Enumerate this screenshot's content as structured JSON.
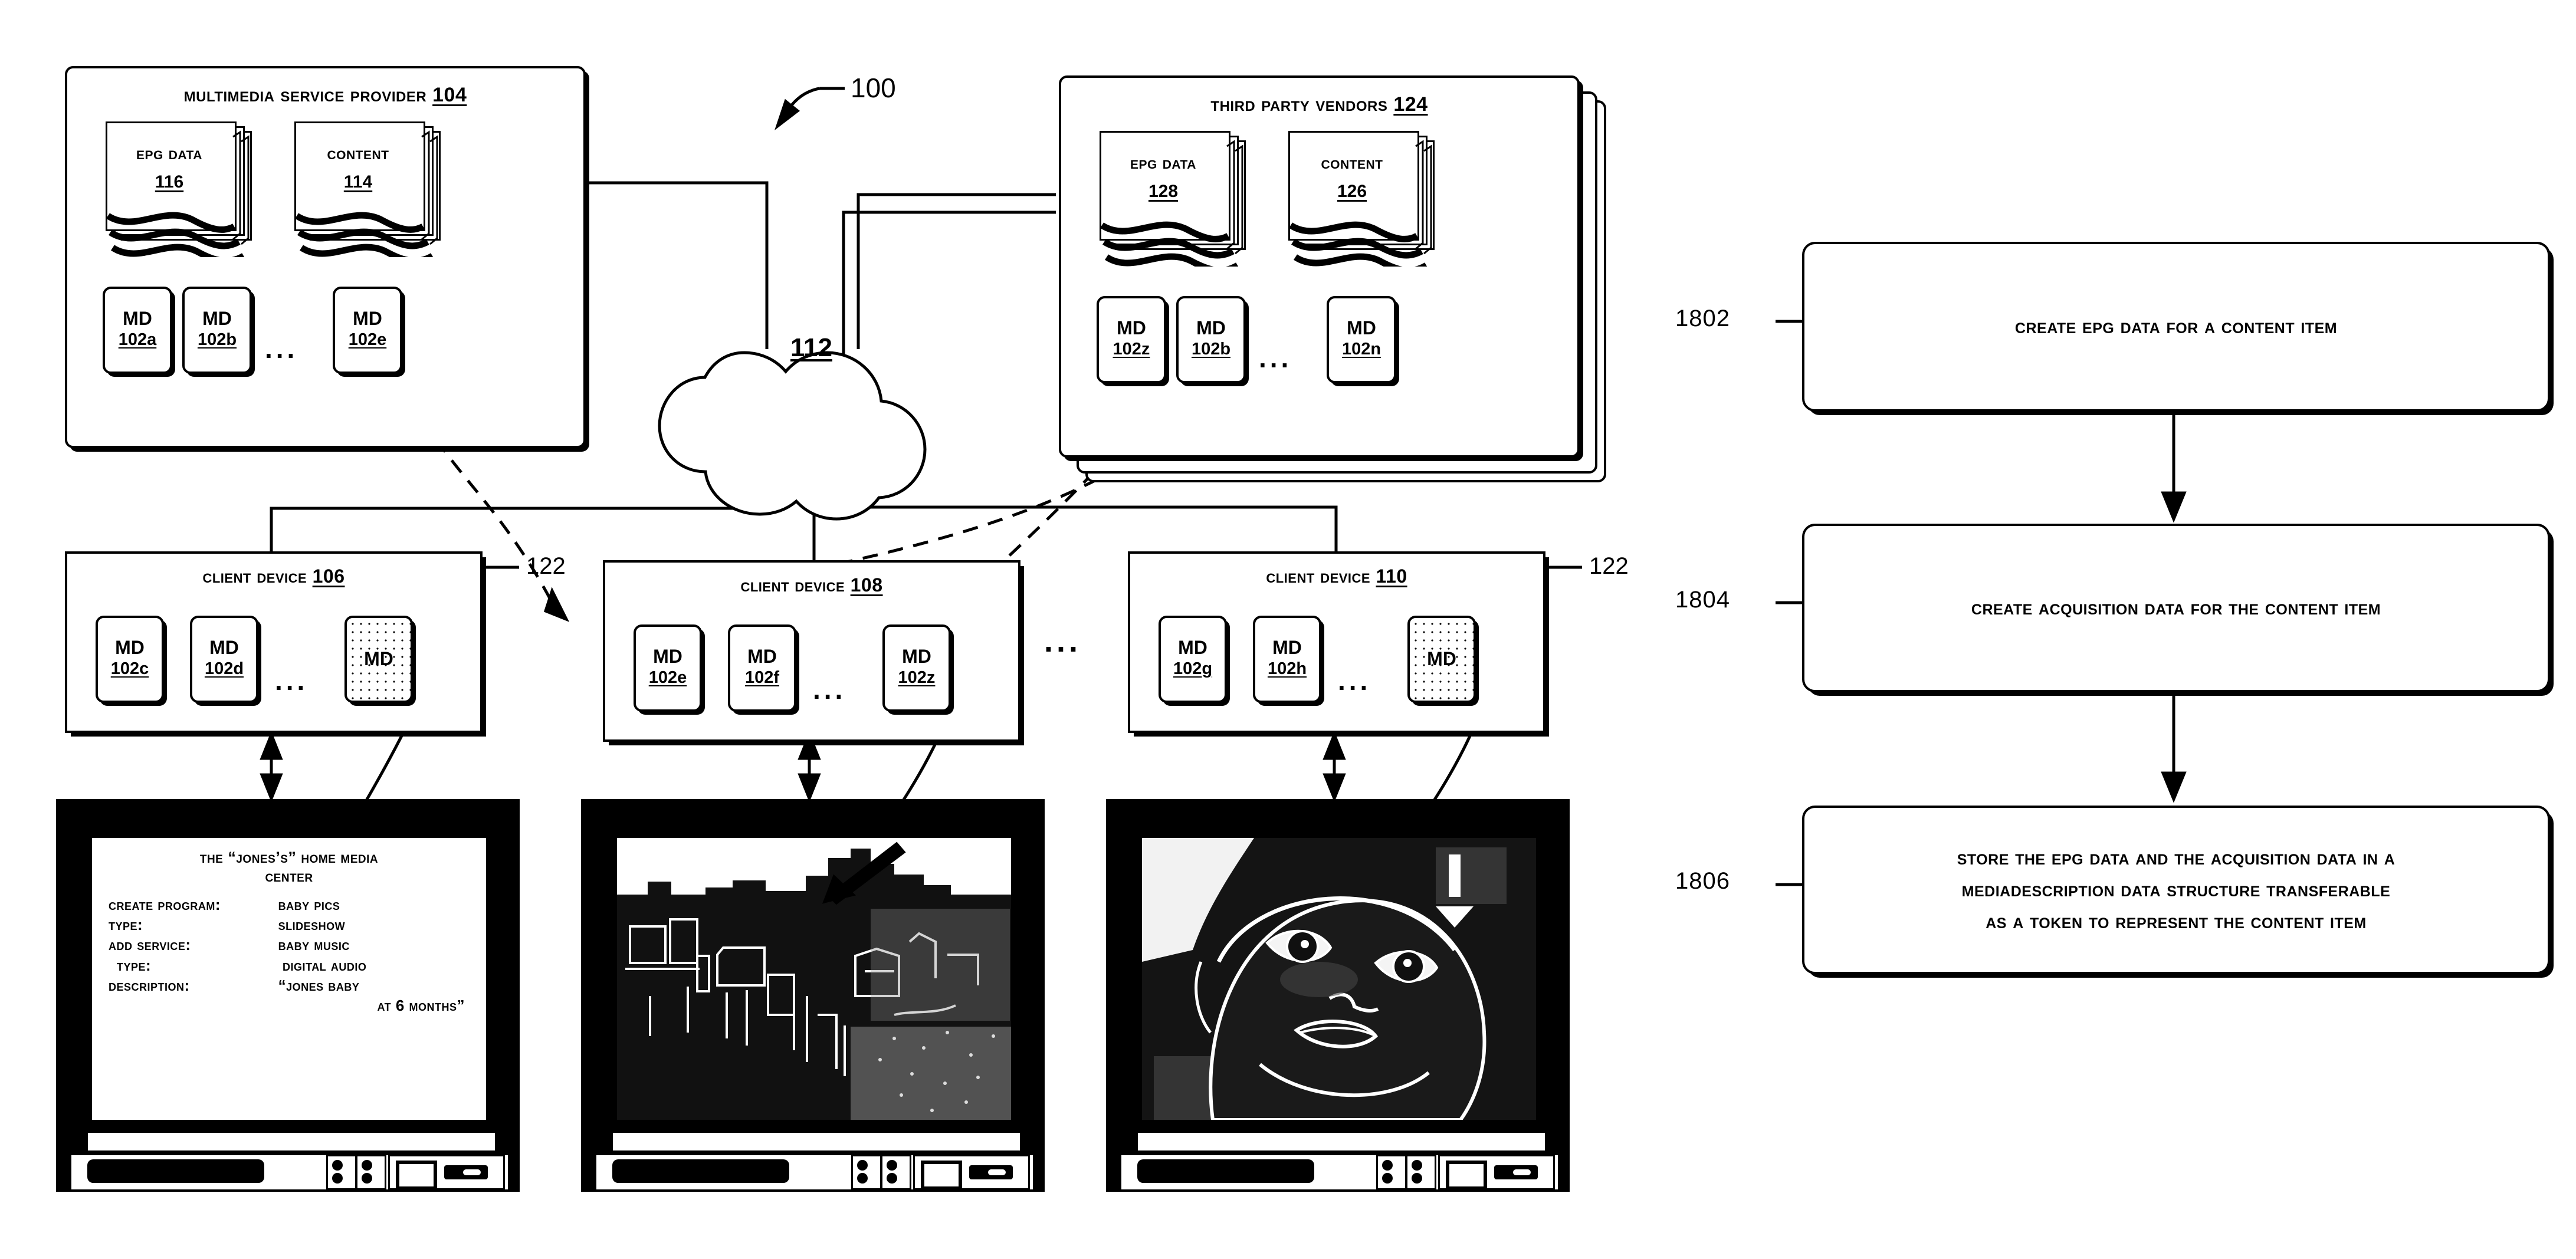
{
  "figure": {
    "reference_100": "100"
  },
  "provider": {
    "title": "Multimedia Service  Provider",
    "ref": "104",
    "epg": {
      "label": "EPG Data",
      "ref": "116"
    },
    "content": {
      "label": "Content",
      "ref": "114"
    },
    "md_items": [
      {
        "label": "MD",
        "ref": "102a"
      },
      {
        "label": "MD",
        "ref": "102b"
      },
      {
        "label": "MD",
        "ref": "102e"
      }
    ],
    "ellipsis": "..."
  },
  "vendors": {
    "title": "Third Party Vendors",
    "ref": "124",
    "epg": {
      "label": "EPG Data",
      "ref": "128"
    },
    "content": {
      "label": "Content",
      "ref": "126"
    },
    "md_items": [
      {
        "label": "MD",
        "ref": "102z"
      },
      {
        "label": "MD",
        "ref": "102b"
      },
      {
        "label": "MD",
        "ref": "102n"
      }
    ],
    "ellipsis": "..."
  },
  "network": {
    "ref": "112"
  },
  "clients": [
    {
      "title": "Client Device",
      "ref": "106",
      "callout": "122",
      "md_items": [
        {
          "label": "MD",
          "ref": "102c",
          "shaded": false
        },
        {
          "label": "MD",
          "ref": "102d",
          "shaded": false
        },
        {
          "label": "MD",
          "ref": "",
          "shaded": true
        }
      ],
      "ellipsis": "..."
    },
    {
      "title": "Client Device",
      "ref": "108",
      "callout": "",
      "md_items": [
        {
          "label": "MD",
          "ref": "102e",
          "shaded": false
        },
        {
          "label": "MD",
          "ref": "102f",
          "shaded": false
        },
        {
          "label": "MD",
          "ref": "102z",
          "shaded": false
        }
      ],
      "ellipsis": "..."
    },
    {
      "title": "Client Device",
      "ref": "110",
      "callout": "122",
      "md_items": [
        {
          "label": "MD",
          "ref": "102g",
          "shaded": false
        },
        {
          "label": "MD",
          "ref": "102h",
          "shaded": false
        },
        {
          "label": "MD",
          "ref": "",
          "shaded": true
        }
      ],
      "ellipsis": "..."
    }
  ],
  "clients_ellipsis": "...",
  "tv_menu": {
    "header_line1": "The “Jones’s” Home Media",
    "header_line2": "Center",
    "rows": [
      {
        "key": "Create Program:",
        "value": "Baby Pics"
      },
      {
        "key": "Type:",
        "value": "Slideshow"
      },
      {
        "key": "Add Service:",
        "value": "Baby Music"
      },
      {
        "key": "Type:",
        "value": "Digital Audio"
      },
      {
        "key": "Description:",
        "value": "“Jones Baby"
      }
    ],
    "description_line2": "at 6 Months”"
  },
  "flowchart": [
    {
      "ref": "1802",
      "text": "Create EPG Data For A Content Item"
    },
    {
      "ref": "1804",
      "text": "Create Acquisition Data For The Content Item"
    },
    {
      "ref": "1806",
      "text_lines": [
        "Store The EPG Data and the Acquisition Data in a",
        "MediaDescription Data Structure Transferable",
        "as a Token to Represent the Content Item"
      ]
    }
  ],
  "colors": {
    "ink": "#000000",
    "paper": "#ffffff"
  }
}
